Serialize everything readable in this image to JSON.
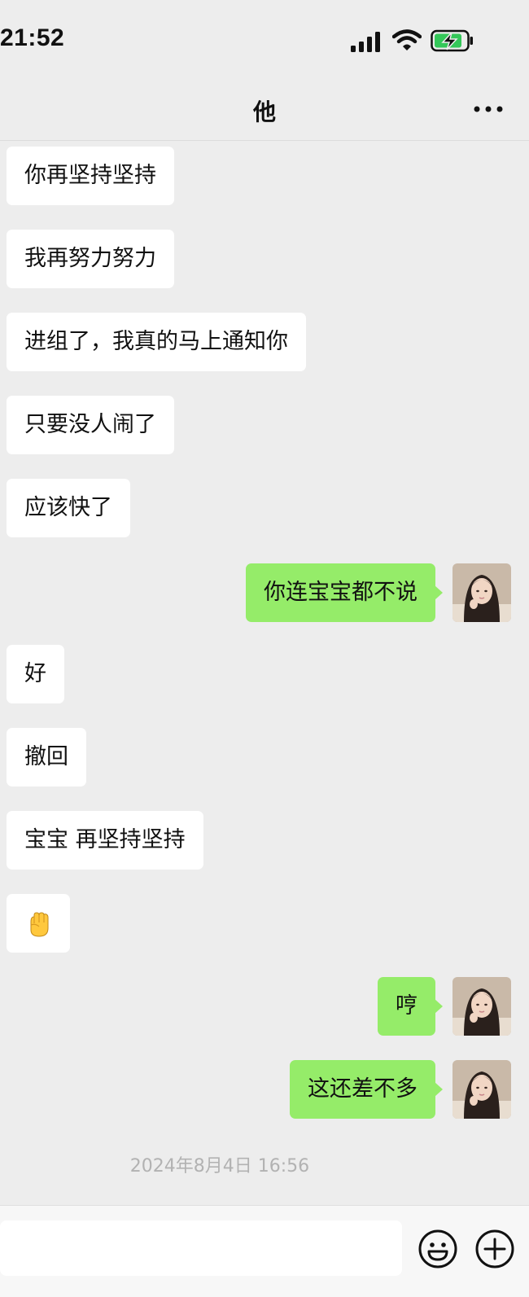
{
  "status_bar": {
    "time": "21:52",
    "battery_state": "charging",
    "battery_color": "#34c759"
  },
  "nav": {
    "title": "他",
    "more_icon": "more-dots-icon"
  },
  "messages": [
    {
      "from": "other",
      "text": "你再坚持坚持"
    },
    {
      "from": "other",
      "text": "我再努力努力"
    },
    {
      "from": "other",
      "text": "进组了，我真的马上通知你"
    },
    {
      "from": "other",
      "text": "只要没人闹了"
    },
    {
      "from": "other",
      "text": "应该快了"
    },
    {
      "from": "me",
      "text": "你连宝宝都不说"
    },
    {
      "from": "other",
      "text": "好"
    },
    {
      "from": "other",
      "text": "撤回"
    },
    {
      "from": "other",
      "text": "宝宝 再坚持坚持"
    },
    {
      "from": "other",
      "emoji": "raised-fist-emoji"
    },
    {
      "from": "me",
      "text": "哼"
    },
    {
      "from": "me",
      "text": "这还差不多"
    }
  ],
  "timestamp": "2024年8月4日 16:56",
  "input_bar": {
    "value": "",
    "emoji_icon": "smiley-face-icon",
    "plus_icon": "plus-circle-icon"
  },
  "colors": {
    "background": "#ededed",
    "sent_bubble": "#95ec69",
    "received_bubble": "#ffffff",
    "timestamp_text": "#b2b2b2"
  }
}
